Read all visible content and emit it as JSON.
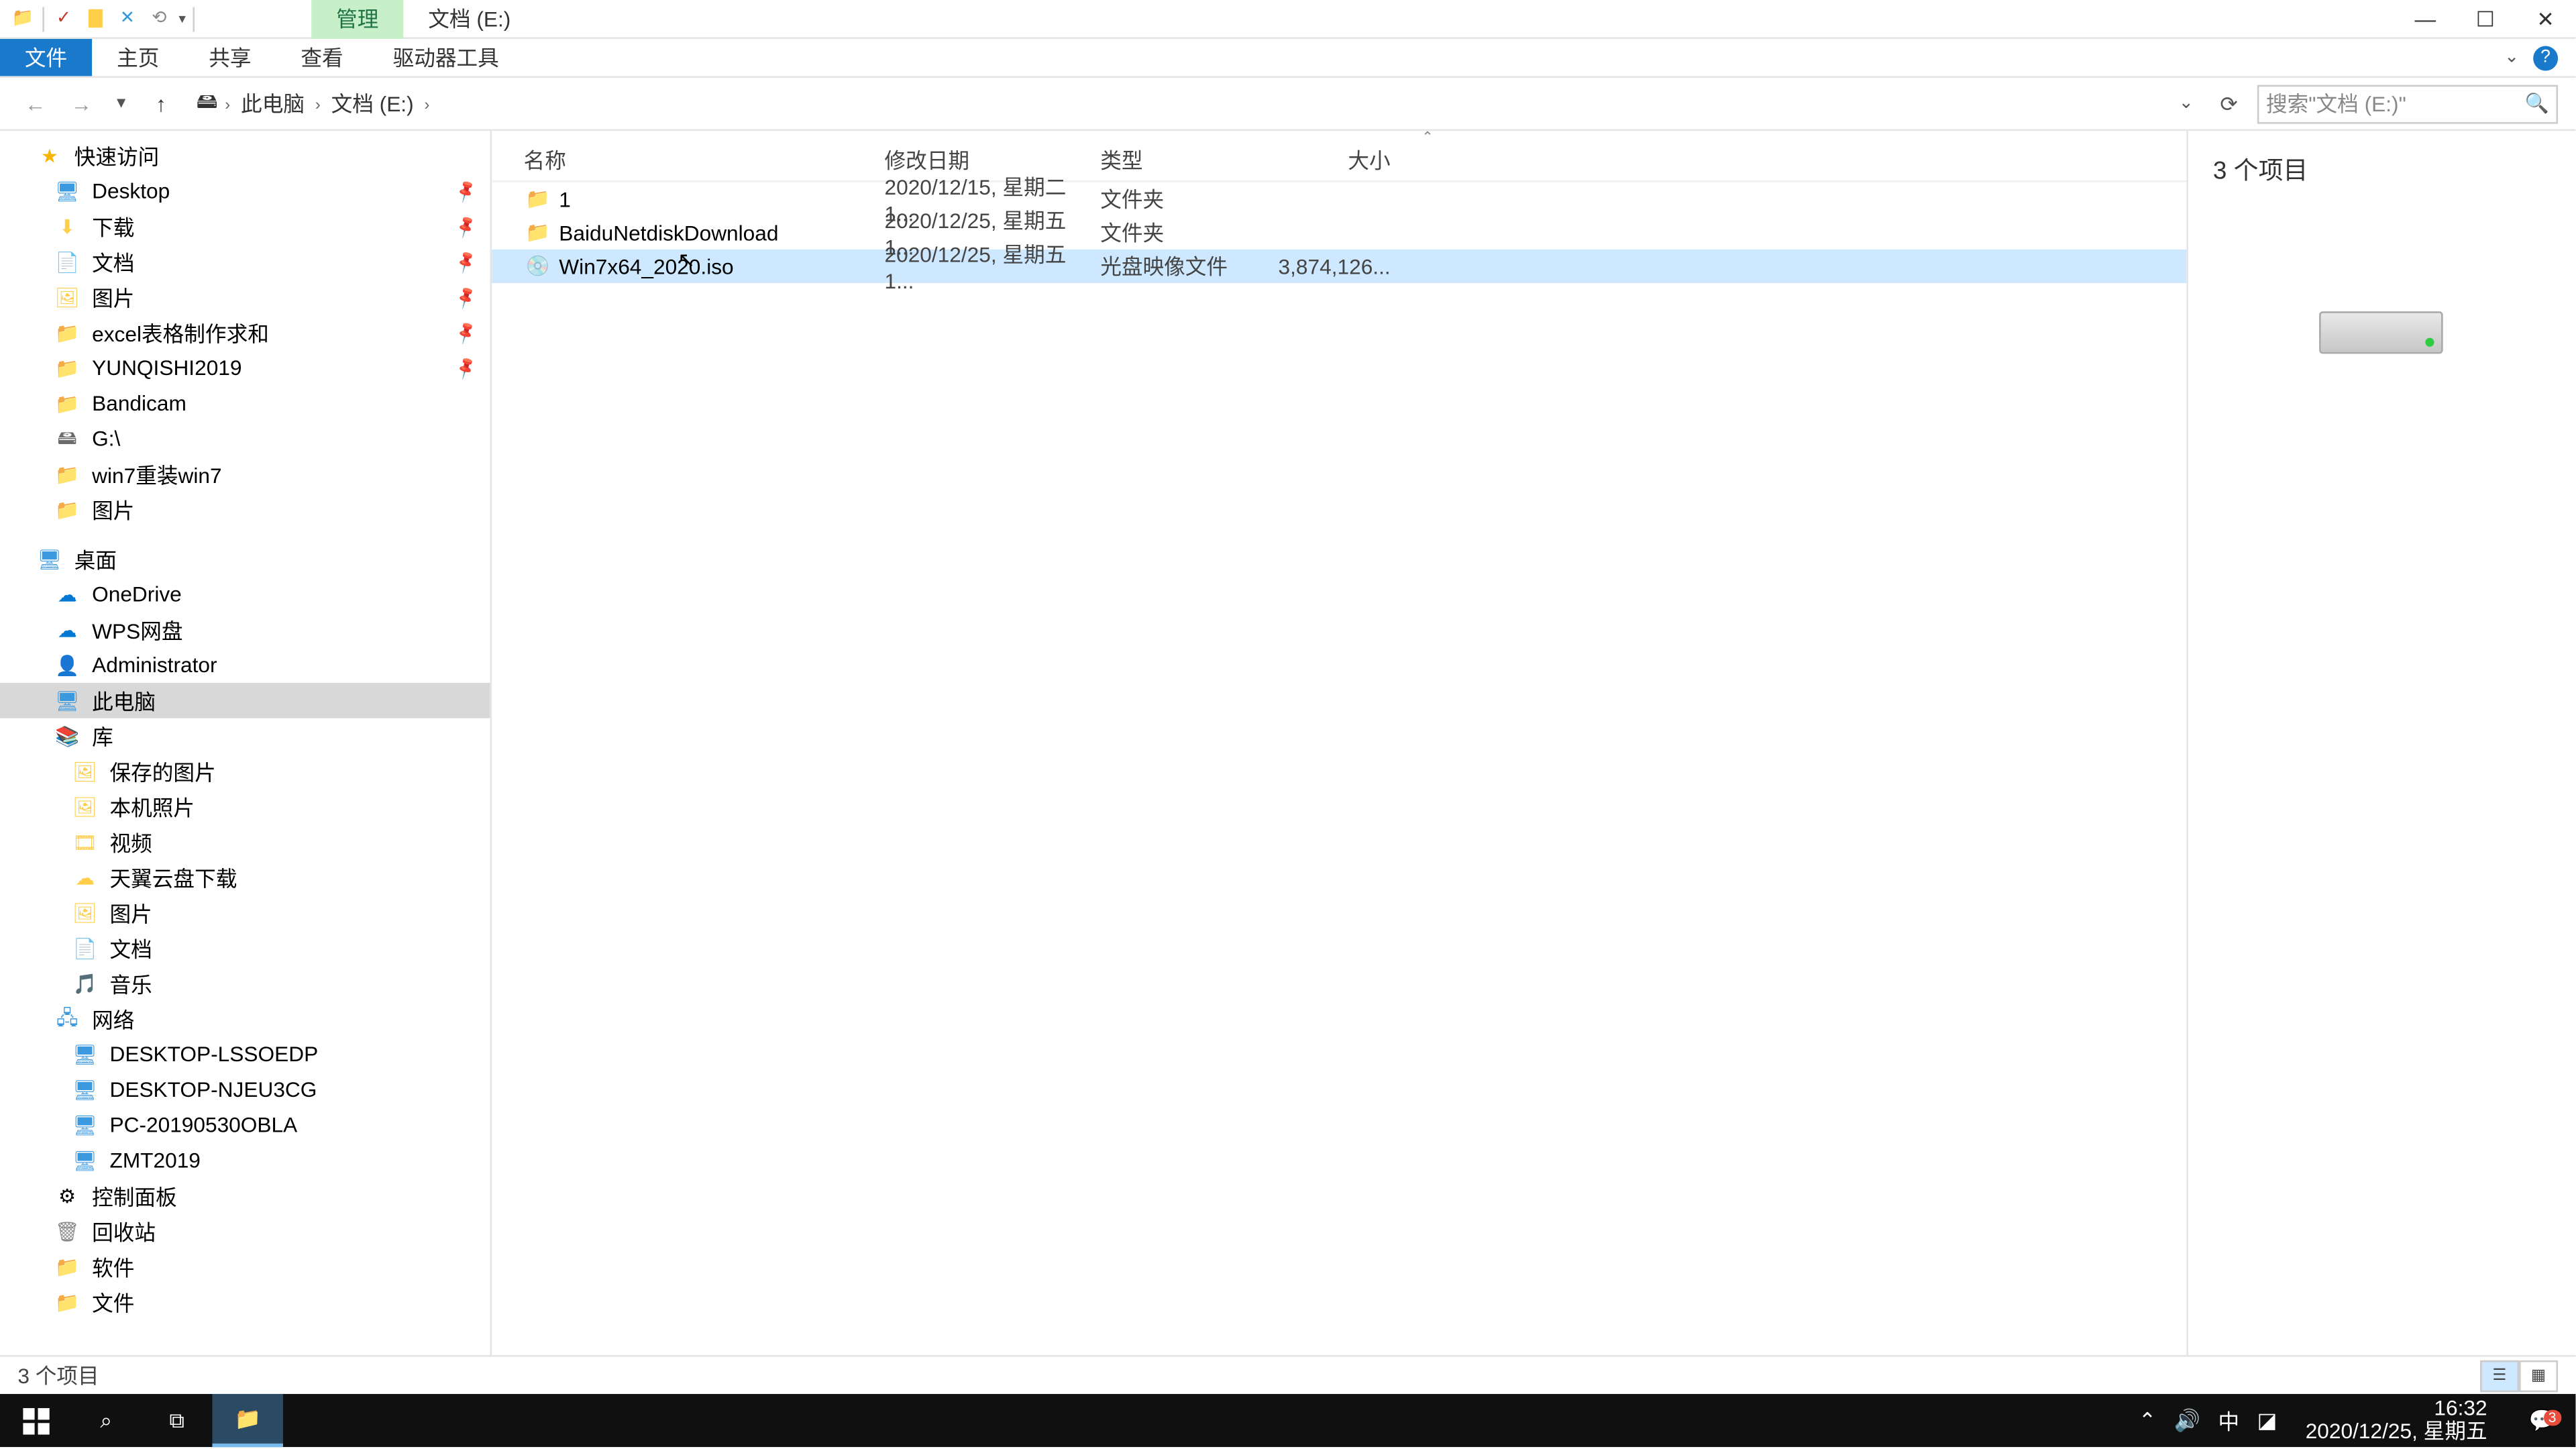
{
  "titlebar": {
    "context_tab": "管理",
    "location_tab": "文档 (E:)"
  },
  "ribbon": {
    "tabs": {
      "file": "文件",
      "home": "主页",
      "share": "共享",
      "view": "查看",
      "drive": "驱动器工具"
    }
  },
  "address": {
    "crumbs": [
      "此电脑",
      "文档 (E:)"
    ],
    "search_placeholder": "搜索\"文档 (E:)\""
  },
  "sidebar": {
    "quick": "快速访问",
    "quick_items": [
      "Desktop",
      "下载",
      "文档",
      "图片",
      "excel表格制作求和",
      "YUNQISHI2019",
      "Bandicam",
      "G:\\",
      "win7重装win7",
      "图片"
    ],
    "desktop": "桌面",
    "desktop_items": [
      "OneDrive",
      "WPS网盘",
      "Administrator",
      "此电脑",
      "库"
    ],
    "lib_items": [
      "保存的图片",
      "本机照片",
      "视频",
      "天翼云盘下载",
      "图片",
      "文档",
      "音乐"
    ],
    "network": "网络",
    "net_items": [
      "DESKTOP-LSSOEDP",
      "DESKTOP-NJEU3CG",
      "PC-20190530OBLA",
      "ZMT2019"
    ],
    "ctrlpanel": "控制面板",
    "recycle": "回收站",
    "soft": "软件",
    "files": "文件"
  },
  "columns": {
    "name": "名称",
    "date": "修改日期",
    "type": "类型",
    "size": "大小"
  },
  "rows": [
    {
      "name": "1",
      "date": "2020/12/15, 星期二 1...",
      "type": "文件夹",
      "size": "",
      "kind": "folder"
    },
    {
      "name": "BaiduNetdiskDownload",
      "date": "2020/12/25, 星期五 1...",
      "type": "文件夹",
      "size": "",
      "kind": "folder"
    },
    {
      "name": "Win7x64_2020.iso",
      "date": "2020/12/25, 星期五 1...",
      "type": "光盘映像文件",
      "size": "3,874,126...",
      "kind": "iso",
      "selected": true
    }
  ],
  "preview": {
    "count": "3 个项目"
  },
  "status": {
    "text": "3 个项目"
  },
  "taskbar": {
    "time": "16:32",
    "date": "2020/12/25, 星期五",
    "ime": "中",
    "notif_count": "3"
  }
}
